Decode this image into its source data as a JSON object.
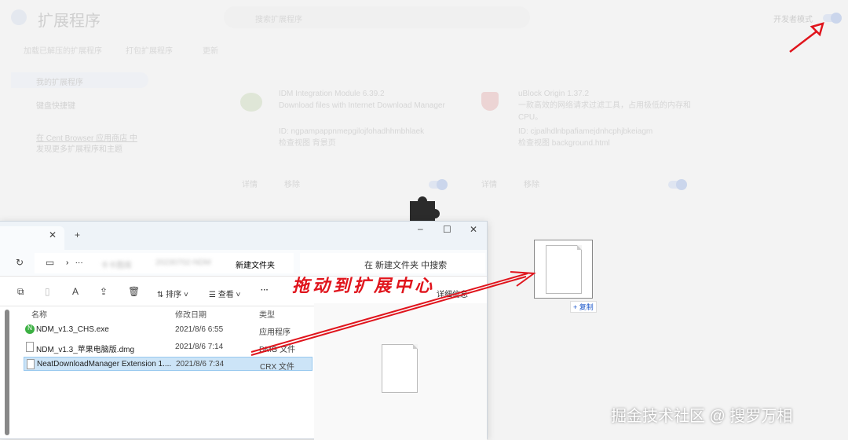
{
  "ext_page": {
    "title": "扩展程序",
    "search_placeholder": "搜索扩展程序",
    "dev_mode": "开发者模式",
    "tabs": [
      "加载已解压的扩展程序",
      "打包扩展程序",
      "更新"
    ],
    "sidebar": [
      "我的扩展程序",
      "键盘快捷键"
    ],
    "store_link": "在 Cent Browser 应用商店 中",
    "store_sub": "发现更多扩展程序和主题",
    "cards": [
      {
        "name": "IDM Integration Module",
        "version": "6.39.2",
        "desc": "Download files with Internet Download Manager",
        "id": "ID: ngpampappnmepgilojfohadhhmbhlaek",
        "views": "检查视图 背景页",
        "details": "详情",
        "remove": "移除"
      },
      {
        "name": "uBlock Origin",
        "version": "1.37.2",
        "desc": "一款高效的网络请求过滤工具，占用极低的内存和CPU。",
        "id": "ID: cjpalhdlnbpafiamejdnhcphjbkeiagm",
        "views": "检查视图 background.html",
        "details": "详情",
        "remove": "移除"
      }
    ]
  },
  "explorer": {
    "path_current": "新建文件夹",
    "path_blurred": [
      "卡卡图库",
      "20230702-NDM"
    ],
    "search_placeholder": "在 新建文件夹 中搜索",
    "toolbar": {
      "sort": "排序",
      "view": "查看",
      "more": "···",
      "details": "详细信息"
    },
    "columns": [
      "名称",
      "修改日期",
      "类型"
    ],
    "files": [
      {
        "name": "NDM_v1.3_CHS.exe",
        "date": "2021/8/6 6:55",
        "type": "应用程序"
      },
      {
        "name": "NDM_v1.3_苹果电脑版.dmg",
        "date": "2021/8/6 7:14",
        "type": "DMG 文件"
      },
      {
        "name": "NeatDownloadManager Extension 1....",
        "date": "2021/8/6 7:34",
        "type": "CRX 文件"
      }
    ]
  },
  "annotation": "拖动到扩展中心",
  "drag_tooltip": "+ 复制",
  "watermark": "掘金技术社区 @ 搜罗万相",
  "colors": {
    "annotation": "#e0141c"
  }
}
